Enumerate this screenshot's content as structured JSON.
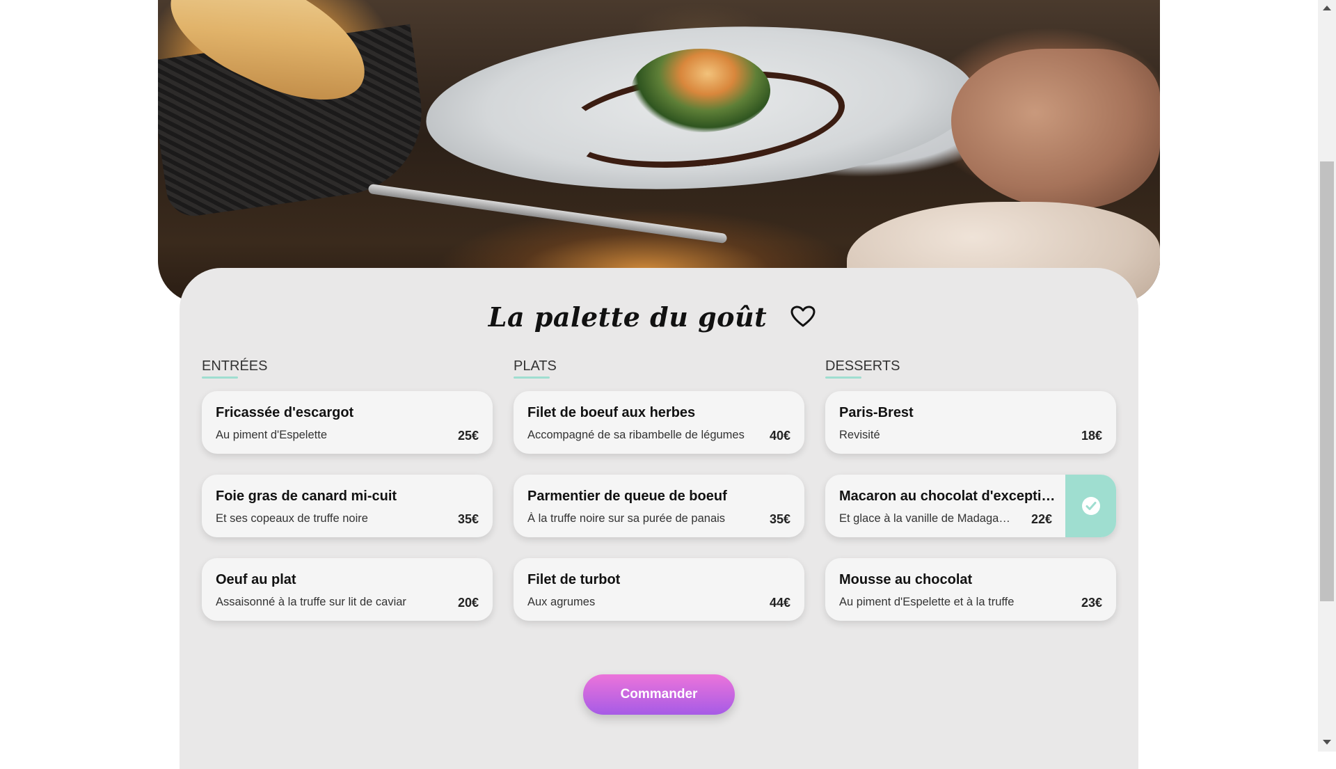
{
  "restaurant": {
    "title": "La palette du goût"
  },
  "menu": {
    "entrees": {
      "heading": "ENTRÉES",
      "items": [
        {
          "name": "Fricassée d'escargot",
          "description": "Au piment d'Espelette",
          "price": "25€"
        },
        {
          "name": "Foie gras de canard mi-cuit",
          "description": "Et ses copeaux de truffe noire",
          "price": "35€"
        },
        {
          "name": "Oeuf au plat",
          "description": "Assaisonné à la truffe sur lit de caviar",
          "price": "20€"
        }
      ]
    },
    "plats": {
      "heading": "PLATS",
      "items": [
        {
          "name": "Filet de boeuf aux herbes",
          "description": "Accompagné de sa ribambelle de légumes",
          "price": "40€"
        },
        {
          "name": "Parmentier de queue de boeuf",
          "description": "À la truffe noire sur sa purée de panais",
          "price": "35€"
        },
        {
          "name": "Filet de turbot",
          "description": "Aux agrumes",
          "price": "44€"
        }
      ]
    },
    "desserts": {
      "heading": "DESSERTS",
      "items": [
        {
          "name": "Paris-Brest",
          "description": "Revisité",
          "price": "18€",
          "selected": false
        },
        {
          "name": "Macaron au chocolat d'exception",
          "description": "Et glace à la vanille de Madagascar",
          "price": "22€",
          "selected": true
        },
        {
          "name": "Mousse au chocolat",
          "description": "Au piment d'Espelette et à la truffe",
          "price": "23€",
          "selected": false
        }
      ]
    }
  },
  "order_button": {
    "label": "Commander"
  },
  "colors": {
    "accent_mint": "#9fded0",
    "button_gradient_top": "#ec74da",
    "button_gradient_bottom": "#a65be6",
    "card_background": "#e9e8e8"
  },
  "icons": {
    "favorite": "heart-icon",
    "selected": "check-circle-icon"
  }
}
